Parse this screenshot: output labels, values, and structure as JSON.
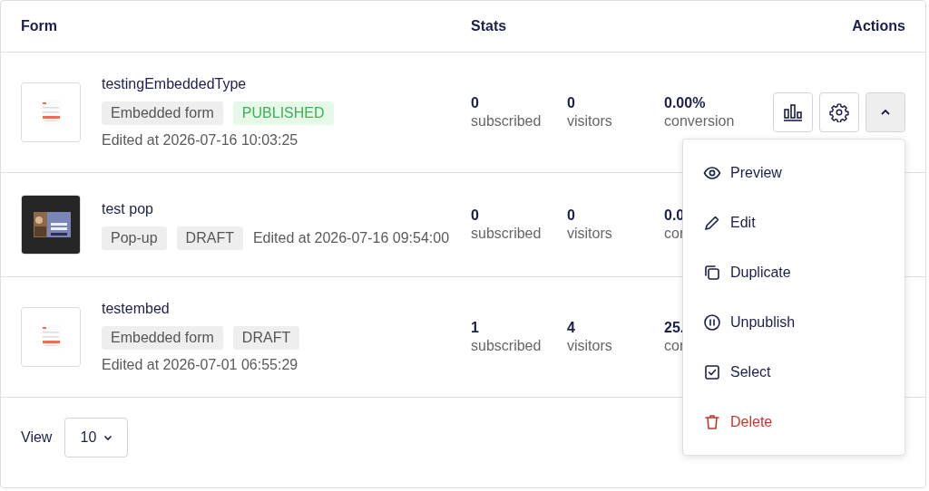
{
  "columns": [
    {
      "label": "Form"
    },
    {
      "label": "Stats"
    },
    {
      "label": "Actions"
    }
  ],
  "rows": [
    {
      "name": "testingEmbeddedType",
      "thumbnail": {
        "kind": "picture",
        "dark": false
      },
      "tags": [
        {
          "label": "Embedded form",
          "kind": "type"
        },
        {
          "label": "PUBLISHED",
          "kind": "published"
        }
      ],
      "edited": "Edited at 2026-07-16 10:03:25",
      "stats": [
        {
          "value": "0",
          "label": "subscribed"
        },
        {
          "value": "0",
          "label": "visitors"
        },
        {
          "value": "0.00%",
          "label": "conversion"
        }
      ],
      "actions": {
        "expanded": true
      }
    },
    {
      "name": "test pop",
      "thumbnail": {
        "kind": "picture",
        "dark": true
      },
      "tags": [
        {
          "label": "Pop-up",
          "kind": "type"
        },
        {
          "label": "DRAFT",
          "kind": "draft"
        }
      ],
      "edited": "Edited at 2026-07-16 09:54:00",
      "stats": [
        {
          "value": "0",
          "label": "subscribed"
        },
        {
          "value": "0",
          "label": "visitors"
        },
        {
          "value": "0.0",
          "label": "cor"
        }
      ]
    },
    {
      "name": "testembed",
      "thumbnail": {
        "kind": "picture",
        "dark": false
      },
      "tags": [
        {
          "label": "Embedded form",
          "kind": "type"
        },
        {
          "label": "DRAFT",
          "kind": "draft"
        }
      ],
      "edited": "Edited at 2026-07-01 06:55:29",
      "stats": [
        {
          "value": "1",
          "label": "subscribed"
        },
        {
          "value": "4",
          "label": "visitors"
        },
        {
          "value": "25.",
          "label": "cor"
        }
      ]
    }
  ],
  "menu": [
    {
      "label": "Preview",
      "kind": "preview"
    },
    {
      "label": "Edit",
      "kind": "edit"
    },
    {
      "label": "Duplicate",
      "kind": "duplicate"
    },
    {
      "label": "Unpublish",
      "kind": "unpublish"
    },
    {
      "label": "Select",
      "kind": "select"
    },
    {
      "label": "Delete",
      "kind": "delete"
    }
  ],
  "footer": {
    "label": "View",
    "page_size": "10"
  }
}
